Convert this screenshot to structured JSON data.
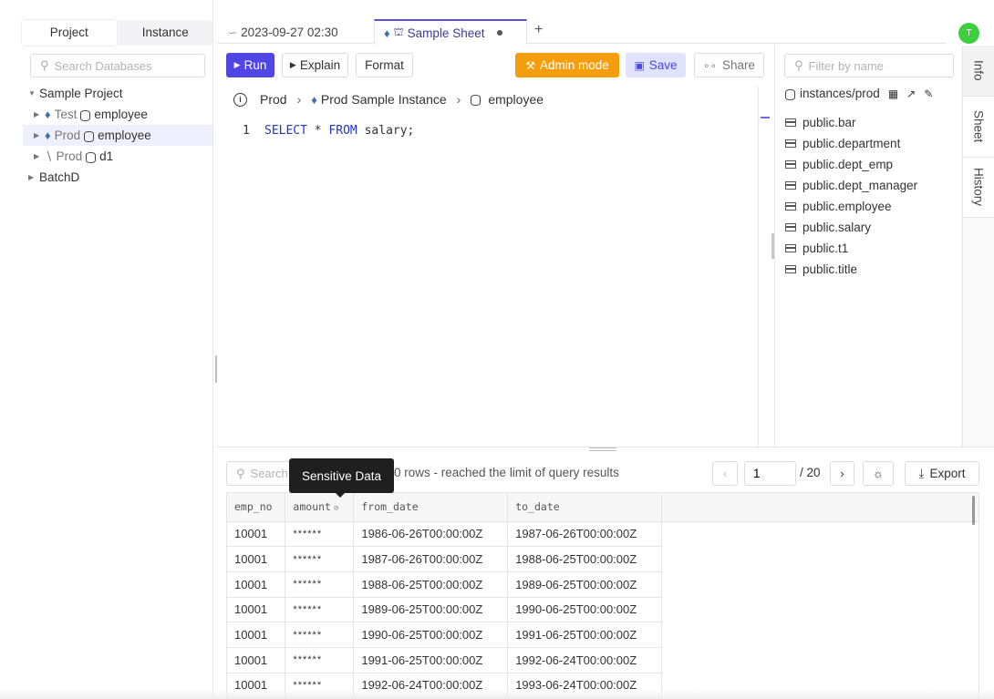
{
  "sidebar": {
    "tabs": [
      "Project",
      "Instance"
    ],
    "search_placeholder": "Search Databases",
    "tree": {
      "project": "Sample Project",
      "items": [
        {
          "env": "Test",
          "db": "employee"
        },
        {
          "env": "Prod",
          "db": "employee"
        },
        {
          "env": "Prod",
          "db": "d1"
        }
      ],
      "other_project": "BatchD"
    }
  },
  "tabs": {
    "tab1_label": "2023-09-27 02:30",
    "tab2_label": "Sample Sheet",
    "add": "+"
  },
  "avatar": {
    "initial": "T",
    "color": "#3ecf3e"
  },
  "toolbar": {
    "run": "Run",
    "explain": "Explain",
    "format": "Format",
    "admin": "Admin mode",
    "save": "Save",
    "share": "Share"
  },
  "breadcrumb": {
    "env": "Prod",
    "instance": "Prod Sample Instance",
    "database": "employee"
  },
  "editor": {
    "line_no": "1",
    "kw_select": "SELECT",
    "star": " * ",
    "kw_from": "FROM",
    "rest": " salary;"
  },
  "schema": {
    "filter_placeholder": "Filter by name",
    "header": "instances/prod",
    "tables": [
      "public.bar",
      "public.department",
      "public.dept_emp",
      "public.dept_manager",
      "public.employee",
      "public.salary",
      "public.t1",
      "public.title"
    ]
  },
  "side_tabs": [
    "Info",
    "Sheet",
    "History"
  ],
  "results": {
    "search_placeholder": "Search",
    "tooltip": "Sensitive Data",
    "status": "0 rows  -  reached the limit of query results",
    "page": "1",
    "total": "/ 20",
    "export": "Export",
    "columns": [
      "emp_no",
      "amount",
      "from_date",
      "to_date"
    ],
    "rows": [
      [
        "10001",
        "******",
        "1986-06-26T00:00:00Z",
        "1987-06-26T00:00:00Z"
      ],
      [
        "10001",
        "******",
        "1987-06-26T00:00:00Z",
        "1988-06-25T00:00:00Z"
      ],
      [
        "10001",
        "******",
        "1988-06-25T00:00:00Z",
        "1989-06-25T00:00:00Z"
      ],
      [
        "10001",
        "******",
        "1989-06-25T00:00:00Z",
        "1990-06-25T00:00:00Z"
      ],
      [
        "10001",
        "******",
        "1990-06-25T00:00:00Z",
        "1991-06-25T00:00:00Z"
      ],
      [
        "10001",
        "******",
        "1991-06-25T00:00:00Z",
        "1992-06-24T00:00:00Z"
      ],
      [
        "10001",
        "******",
        "1992-06-24T00:00:00Z",
        "1993-06-24T00:00:00Z"
      ]
    ]
  },
  "colors": {
    "accent": "#4f46e5",
    "admin": "#f59e0b",
    "save_bg": "#e0e3fb"
  }
}
